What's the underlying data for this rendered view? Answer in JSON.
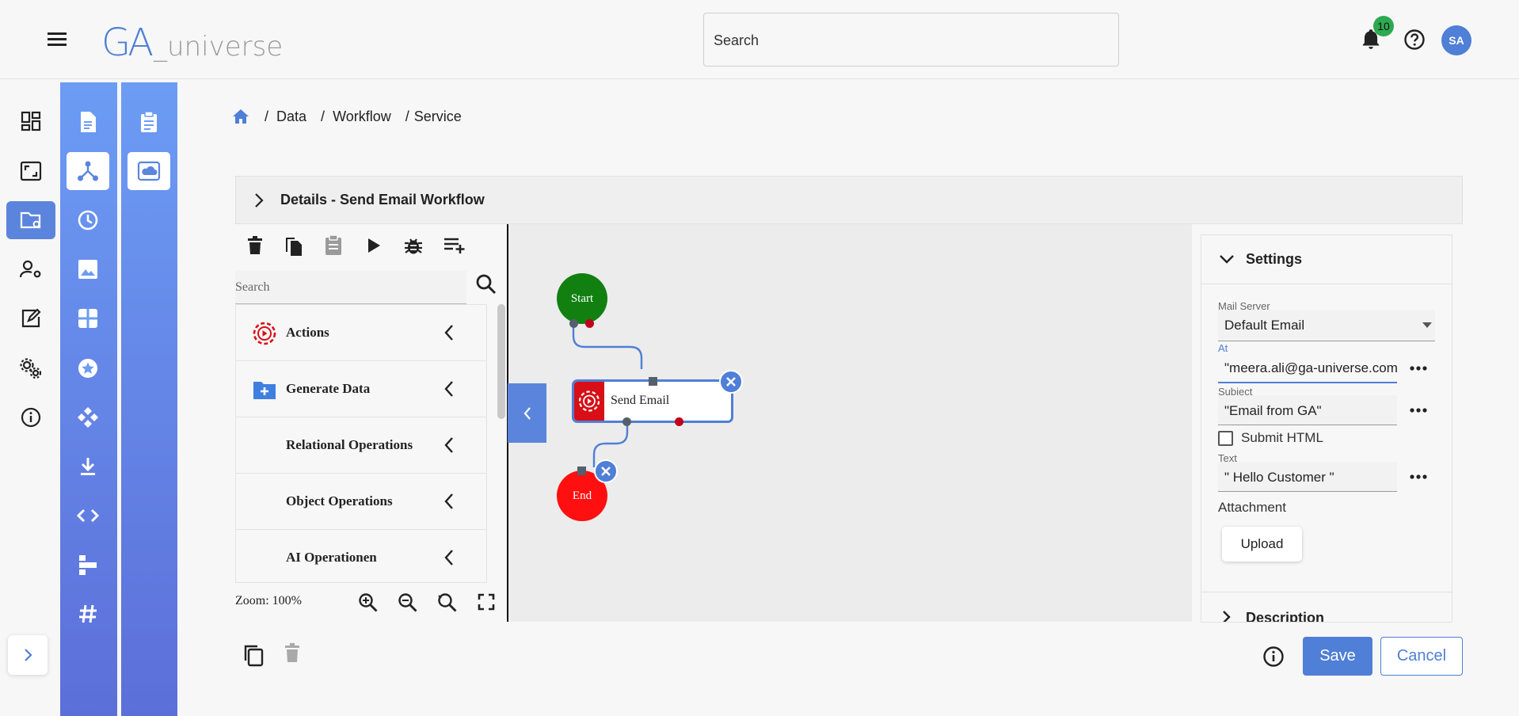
{
  "app": {
    "logo_main": "GA",
    "logo_sub": "_universe"
  },
  "header": {
    "search_label": "Search",
    "notification_count": "10",
    "avatar_initials": "SA"
  },
  "breadcrumb": [
    "Data",
    "Workflow",
    "Service"
  ],
  "details": {
    "title": "Details - Send Email Workflow"
  },
  "palette": {
    "search_placeholder": "Search",
    "items": [
      {
        "label": "Actions",
        "icon": "play-circle-icon"
      },
      {
        "label": "Generate Data",
        "icon": "folder-plus-icon"
      },
      {
        "label": "Relational Operations",
        "icon": ""
      },
      {
        "label": "Object Operations",
        "icon": ""
      },
      {
        "label": "AI Operationen",
        "icon": ""
      }
    ],
    "zoom_text": "Zoom: 100%"
  },
  "workflow": {
    "start_label": "Start",
    "action_label": "Send Email",
    "end_label": "End"
  },
  "settings": {
    "title": "Settings",
    "mail_server_label": "Mail Server",
    "mail_server_value": "Default Email",
    "at_label": "At",
    "at_value": "\"meera.ali@ga-universe.com\"",
    "subject_label": "Subject",
    "subject_value": "\"Email from GA\"",
    "submit_html_label": "Submit HTML",
    "submit_html_checked": false,
    "text_label": "Text",
    "text_value": "\" Hello Customer \"",
    "attachment_label": "Attachment",
    "upload_label": "Upload",
    "description_title": "Description"
  },
  "footer": {
    "save_label": "Save",
    "cancel_label": "Cancel"
  },
  "colors": {
    "accent": "#4f7fd6",
    "start": "#118011",
    "end": "#ff0f0f",
    "action": "#d80f16",
    "badge": "#2da94f"
  }
}
